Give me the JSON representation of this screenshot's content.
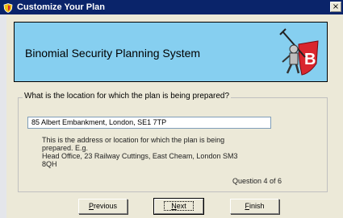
{
  "window": {
    "title": "Customize Your Plan",
    "close_label": "×"
  },
  "banner": {
    "title": "Binomial Security Planning System",
    "logo_letter": "B"
  },
  "question": {
    "legend": "What is the location for which the plan is being prepared?",
    "input_value": "85 Albert Embankment, London, SE1 7TP",
    "help_lines": [
      "This is the address or location for which the plan is being",
      "prepared. E.g.",
      "Head Office, 23 Railway Cuttings, East Cheam, London SM3",
      "8QH"
    ],
    "progress_text": "Question 4 of 6"
  },
  "buttons": {
    "previous": {
      "first": "P",
      "rest": "revious"
    },
    "next": {
      "first": "N",
      "rest": "ext"
    },
    "finish": {
      "first": "F",
      "rest": "inish"
    }
  },
  "colors": {
    "titlebar": "#0a246a",
    "banner": "#86cff0",
    "logo_red": "#d9262e"
  },
  "icons": {
    "title_icon": "shield-icon",
    "logo": "knight-logo-icon"
  }
}
